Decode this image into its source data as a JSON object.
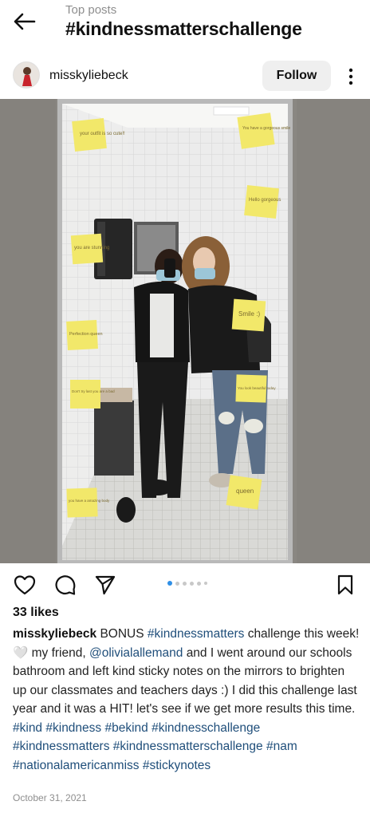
{
  "header": {
    "subtitle": "Top posts",
    "title": "#kindnessmatterschallenge"
  },
  "post": {
    "username": "misskyliebeck",
    "follow_label": "Follow",
    "likes": "33 likes",
    "caption": {
      "user": "misskyliebeck",
      "text_1": "BONUS",
      "tag_1": "#kindnessmatters",
      "text_2": "challenge this week! 🤍 my friend,",
      "mention": "@olivialallemand",
      "text_3": "and I went around our schools bathroom and left kind sticky notes on the mirrors to brighten up our classmates and teachers days :) I did this challenge last year and it was a HIT! let's see if we get more results this time.",
      "hashtags": [
        "#kind",
        "#kindness",
        "#bekind",
        "#kindnesschallenge",
        "#kindnessmatters",
        "#kindnessmatterschallenge",
        "#nam",
        "#nationalamericanmiss",
        "#stickynotes"
      ]
    },
    "date": "October 31, 2021",
    "carousel": {
      "count": 6,
      "active_index": 0
    },
    "sticky_notes": [
      "your outfit is so cute!!",
      "You have a gorgeous smile",
      "Hello gorgeous",
      "you are stunning",
      "Smile :)",
      "Perfection queen",
      "Don't try last you are a bad",
      "You look beautiful today",
      "you have a amazing body",
      "queen"
    ]
  },
  "icons": {
    "back": "arrow-left-icon",
    "more": "more-vertical-icon",
    "like": "heart-icon",
    "comment": "comment-icon",
    "share": "send-icon",
    "save": "bookmark-icon"
  },
  "colors": {
    "link": "#1f4e7a",
    "accent_dot": "#2f8fe6",
    "follow_bg": "#efefef",
    "sticky": "#f2e86a"
  }
}
